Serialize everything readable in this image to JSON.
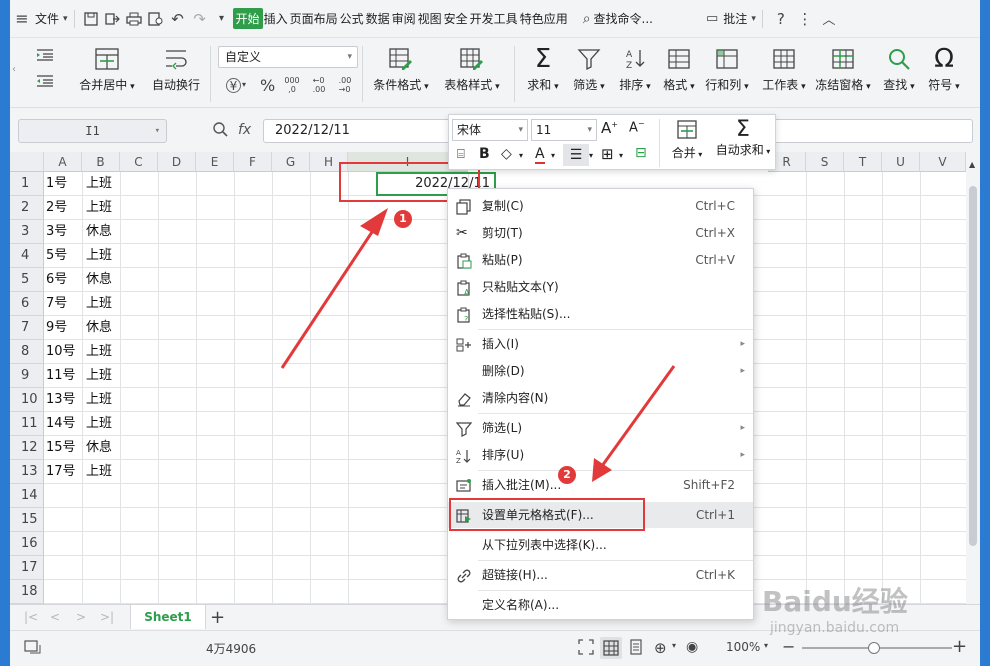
{
  "menubar": {
    "file": "文件",
    "tabs": [
      "开始",
      "插入",
      "页面布局",
      "公式",
      "数据",
      "审阅",
      "视图",
      "安全",
      "开发工具",
      "特色应用"
    ],
    "active_tab": "开始",
    "search": "查找命令...",
    "comment": "批注"
  },
  "ribbon": {
    "merge_center": "合并居中",
    "auto_wrap": "自动换行",
    "format_select": "自定义",
    "cond_format": "条件格式",
    "table_style": "表格样式",
    "sum": "求和",
    "filter": "筛选",
    "sort": "排序",
    "format": "格式",
    "row_col": "行和列",
    "sheet": "工作表",
    "freeze": "冻结窗格",
    "find": "查找",
    "symbol": "符号"
  },
  "formula_bar": {
    "name_box": "I1",
    "fx_label": "fx",
    "value": "2022/12/11"
  },
  "grid": {
    "columns": [
      "A",
      "B",
      "C",
      "D",
      "E",
      "F",
      "G",
      "H",
      "I",
      "R",
      "S",
      "T",
      "U",
      "V"
    ],
    "rows": [
      "1",
      "2",
      "3",
      "4",
      "5",
      "6",
      "7",
      "8",
      "9",
      "10",
      "11",
      "12",
      "13",
      "14",
      "15",
      "16",
      "17",
      "18"
    ],
    "col_a": [
      "1号",
      "2号",
      "3号",
      "5号",
      "6号",
      "7号",
      "9号",
      "10号",
      "11号",
      "13号",
      "14号",
      "15号",
      "17号"
    ],
    "col_b": [
      "上班",
      "上班",
      "休息",
      "上班",
      "休息",
      "上班",
      "休息",
      "上班",
      "上班",
      "上班",
      "上班",
      "休息",
      "上班"
    ],
    "selected_cell_value": "2022/12/11"
  },
  "mini_toolbar": {
    "font": "宋体",
    "size": "11",
    "bold": "B",
    "merge": "合并",
    "auto_sum": "自动求和"
  },
  "context_menu": {
    "items": [
      {
        "label": "复制(C)",
        "shortcut": "Ctrl+C"
      },
      {
        "label": "剪切(T)",
        "shortcut": "Ctrl+X"
      },
      {
        "label": "粘贴(P)",
        "shortcut": "Ctrl+V"
      },
      {
        "label": "只粘贴文本(Y)",
        "shortcut": ""
      },
      {
        "label": "选择性粘贴(S)...",
        "shortcut": ""
      },
      {
        "label": "插入(I)",
        "shortcut": ""
      },
      {
        "label": "删除(D)",
        "shortcut": ""
      },
      {
        "label": "清除内容(N)",
        "shortcut": ""
      },
      {
        "label": "筛选(L)",
        "shortcut": ""
      },
      {
        "label": "排序(U)",
        "shortcut": ""
      },
      {
        "label": "插入批注(M)...",
        "shortcut": "Shift+F2"
      },
      {
        "label": "设置单元格格式(F)...",
        "shortcut": "Ctrl+1"
      },
      {
        "label": "从下拉列表中选择(K)...",
        "shortcut": ""
      },
      {
        "label": "超链接(H)...",
        "shortcut": "Ctrl+K"
      },
      {
        "label": "定义名称(A)...",
        "shortcut": ""
      }
    ]
  },
  "sheet_tabs": {
    "active": "Sheet1"
  },
  "status": {
    "count": "4万4906",
    "zoom": "100%"
  },
  "badges": {
    "one": "1",
    "two": "2"
  },
  "watermark": {
    "brand": "Baidu经验",
    "url": "jingyan.baidu.com"
  },
  "colors": {
    "accent": "#2e9e4a",
    "annotation": "#e23a3a"
  }
}
